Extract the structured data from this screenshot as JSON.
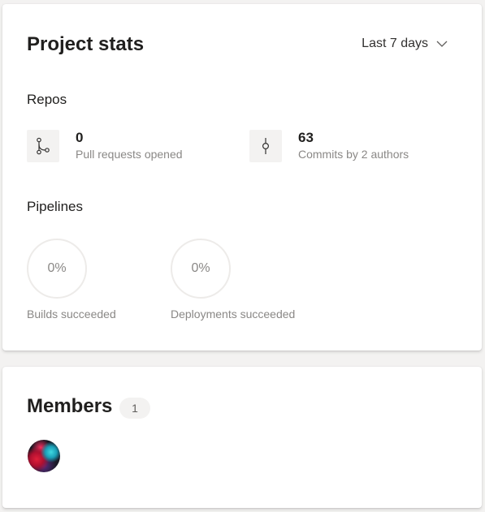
{
  "project_stats": {
    "title": "Project stats",
    "time_range": "Last 7 days",
    "repos": {
      "label": "Repos",
      "metrics": [
        {
          "value": "0",
          "label": "Pull requests opened",
          "icon": "pull-request-icon"
        },
        {
          "value": "63",
          "label": "Commits by 2 authors",
          "icon": "commit-icon"
        }
      ]
    },
    "pipelines": {
      "label": "Pipelines",
      "metrics": [
        {
          "value": "0%",
          "label": "Builds succeeded"
        },
        {
          "value": "0%",
          "label": "Deployments succeeded"
        }
      ]
    }
  },
  "members": {
    "title": "Members",
    "count": "1",
    "avatars": [
      {
        "icon": "user-avatar"
      }
    ]
  },
  "colors": {
    "card_background": "#ffffff",
    "page_background": "#f3f2f1",
    "muted_text": "#8a8886",
    "ring_track": "#edebe9"
  }
}
